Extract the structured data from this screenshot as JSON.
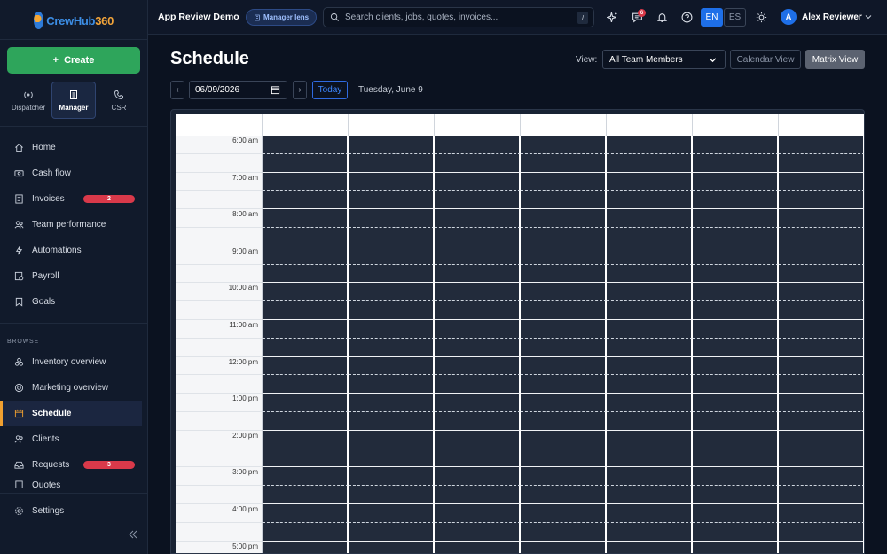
{
  "brand": {
    "name_part1": "CrewHub",
    "name_part2": "360"
  },
  "sidebar": {
    "create_label": "Create",
    "lenses": [
      {
        "label": "Dispatcher",
        "icon": "broadcast-icon",
        "active": false
      },
      {
        "label": "Manager",
        "icon": "building-icon",
        "active": true
      },
      {
        "label": "CSR",
        "icon": "phone-icon",
        "active": false
      }
    ],
    "primary_items": [
      {
        "label": "Home",
        "icon": "home-icon"
      },
      {
        "label": "Cash flow",
        "icon": "cash-icon"
      },
      {
        "label": "Invoices",
        "icon": "invoice-icon",
        "badge": "2"
      },
      {
        "label": "Team performance",
        "icon": "team-icon"
      },
      {
        "label": "Automations",
        "icon": "bolt-icon"
      },
      {
        "label": "Payroll",
        "icon": "payroll-icon"
      },
      {
        "label": "Goals",
        "icon": "goal-icon"
      }
    ],
    "browse_label": "BROWSE",
    "browse_items": [
      {
        "label": "Inventory overview",
        "icon": "inventory-icon"
      },
      {
        "label": "Marketing overview",
        "icon": "target-icon"
      },
      {
        "label": "Schedule",
        "icon": "calendar-icon",
        "active": true
      },
      {
        "label": "Clients",
        "icon": "clients-icon"
      },
      {
        "label": "Requests",
        "icon": "inbox-icon",
        "badge": "3"
      },
      {
        "label": "Quotes",
        "icon": "quote-icon"
      }
    ],
    "settings_label": "Settings"
  },
  "topbar": {
    "org_name": "App Review Demo",
    "lens_pill": "Manager lens",
    "search_placeholder": "Search clients, jobs, quotes, invoices...",
    "search_shortcut": "/",
    "notification_count": "6",
    "languages": [
      "EN",
      "ES"
    ],
    "active_language": "EN",
    "user_initial": "A",
    "user_name": "Alex Reviewer"
  },
  "schedule": {
    "title": "Schedule",
    "view_label": "View:",
    "view_selected": "All Team Members",
    "calendar_view_label": "Calendar View",
    "matrix_view_label": "Matrix View",
    "prev_label": "‹",
    "next_label": "›",
    "date_value": "06/09/2026",
    "today_label": "Today",
    "date_display": "Tuesday, June 9",
    "time_slots": [
      "6:00 am",
      "7:00 am",
      "8:00 am",
      "9:00 am",
      "10:00 am",
      "11:00 am",
      "12:00 pm",
      "1:00 pm",
      "2:00 pm",
      "3:00 pm",
      "4:00 pm",
      "5:00 pm"
    ],
    "member_columns": 7
  },
  "colors": {
    "accent": "#1e6fe8",
    "create": "#2ea55b",
    "badge": "#d9394a",
    "active_marker": "#f0a030"
  }
}
